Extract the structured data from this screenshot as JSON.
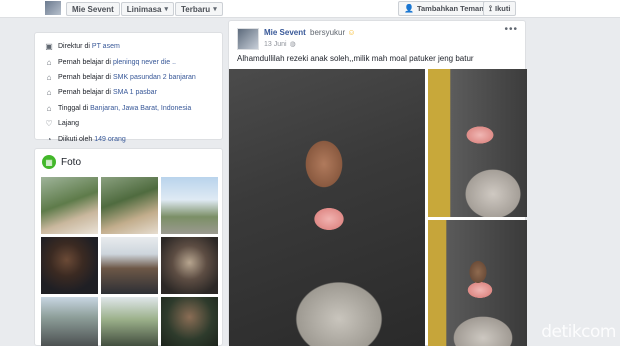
{
  "header": {
    "name_tab": "Mie Sevent",
    "timeline_tab": "Linimasa",
    "recent_tab": "Terbaru",
    "add_friend_label": "Tambahkan Teman",
    "follow_label": "Ikuti"
  },
  "intro": {
    "rows": [
      {
        "icon": "briefcase-icon",
        "prefix": "Direktur di",
        "link": "PT asem"
      },
      {
        "icon": "graduation-cap-icon",
        "prefix": "Pernah belajar di",
        "link": "pleningq never die .."
      },
      {
        "icon": "graduation-cap-icon",
        "prefix": "Pernah belajar di",
        "link": "SMK pasundan 2 banjaran"
      },
      {
        "icon": "graduation-cap-icon",
        "prefix": "Pernah belajar di",
        "link": "SMA 1 pasbar"
      },
      {
        "icon": "home-icon",
        "prefix": "Tinggal di",
        "link": "Banjaran, Jawa Barat, Indonesia"
      },
      {
        "icon": "heart-icon",
        "prefix": "Lajang",
        "link": ""
      },
      {
        "icon": "rss-icon",
        "prefix": "Diikuti oleh",
        "link": "149 orang"
      }
    ]
  },
  "photos": {
    "title": "Foto"
  },
  "post": {
    "author": "Mie Sevent",
    "activity": "bersyukur",
    "date": "13 Juni",
    "text": "Alhamdullilah rezeki anak soleh,,milik mah moal patuker jeng batur"
  },
  "watermark": "detikcom",
  "colors": {
    "link": "#385898",
    "background": "#e9ebee",
    "photos_icon": "#42b72a"
  }
}
